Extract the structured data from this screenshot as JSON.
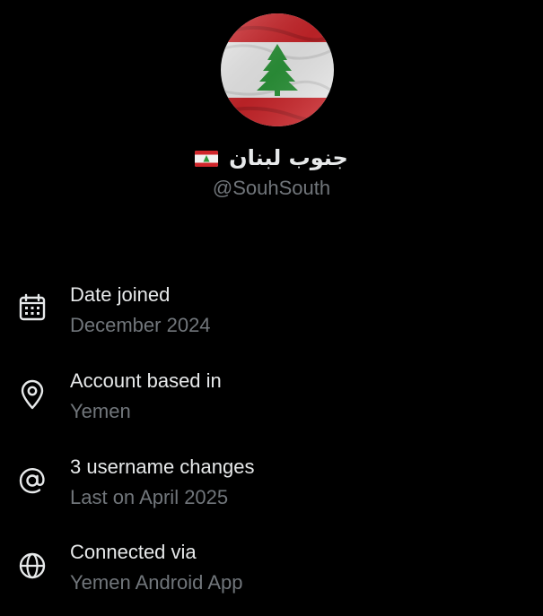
{
  "profile": {
    "display_name": "جنوب لبنان",
    "flag_icon": "lebanon-flag-icon",
    "handle": "@SouhSouth",
    "avatar_icon": "lebanon-flag-avatar"
  },
  "details": [
    {
      "icon": "calendar-icon",
      "label": "Date joined",
      "value": "December 2024"
    },
    {
      "icon": "location-pin-icon",
      "label": "Account based in",
      "value": "Yemen"
    },
    {
      "icon": "at-sign-icon",
      "label": "3 username changes",
      "value": "Last on April 2025"
    },
    {
      "icon": "globe-icon",
      "label": "Connected via",
      "value": "Yemen Android App"
    }
  ],
  "colors": {
    "background": "#000000",
    "primary_text": "#e7e9ea",
    "secondary_text": "#71767b",
    "flag_red": "#d0262b",
    "flag_white": "#f2f2f2",
    "cedar_green": "#2e9a3c"
  }
}
